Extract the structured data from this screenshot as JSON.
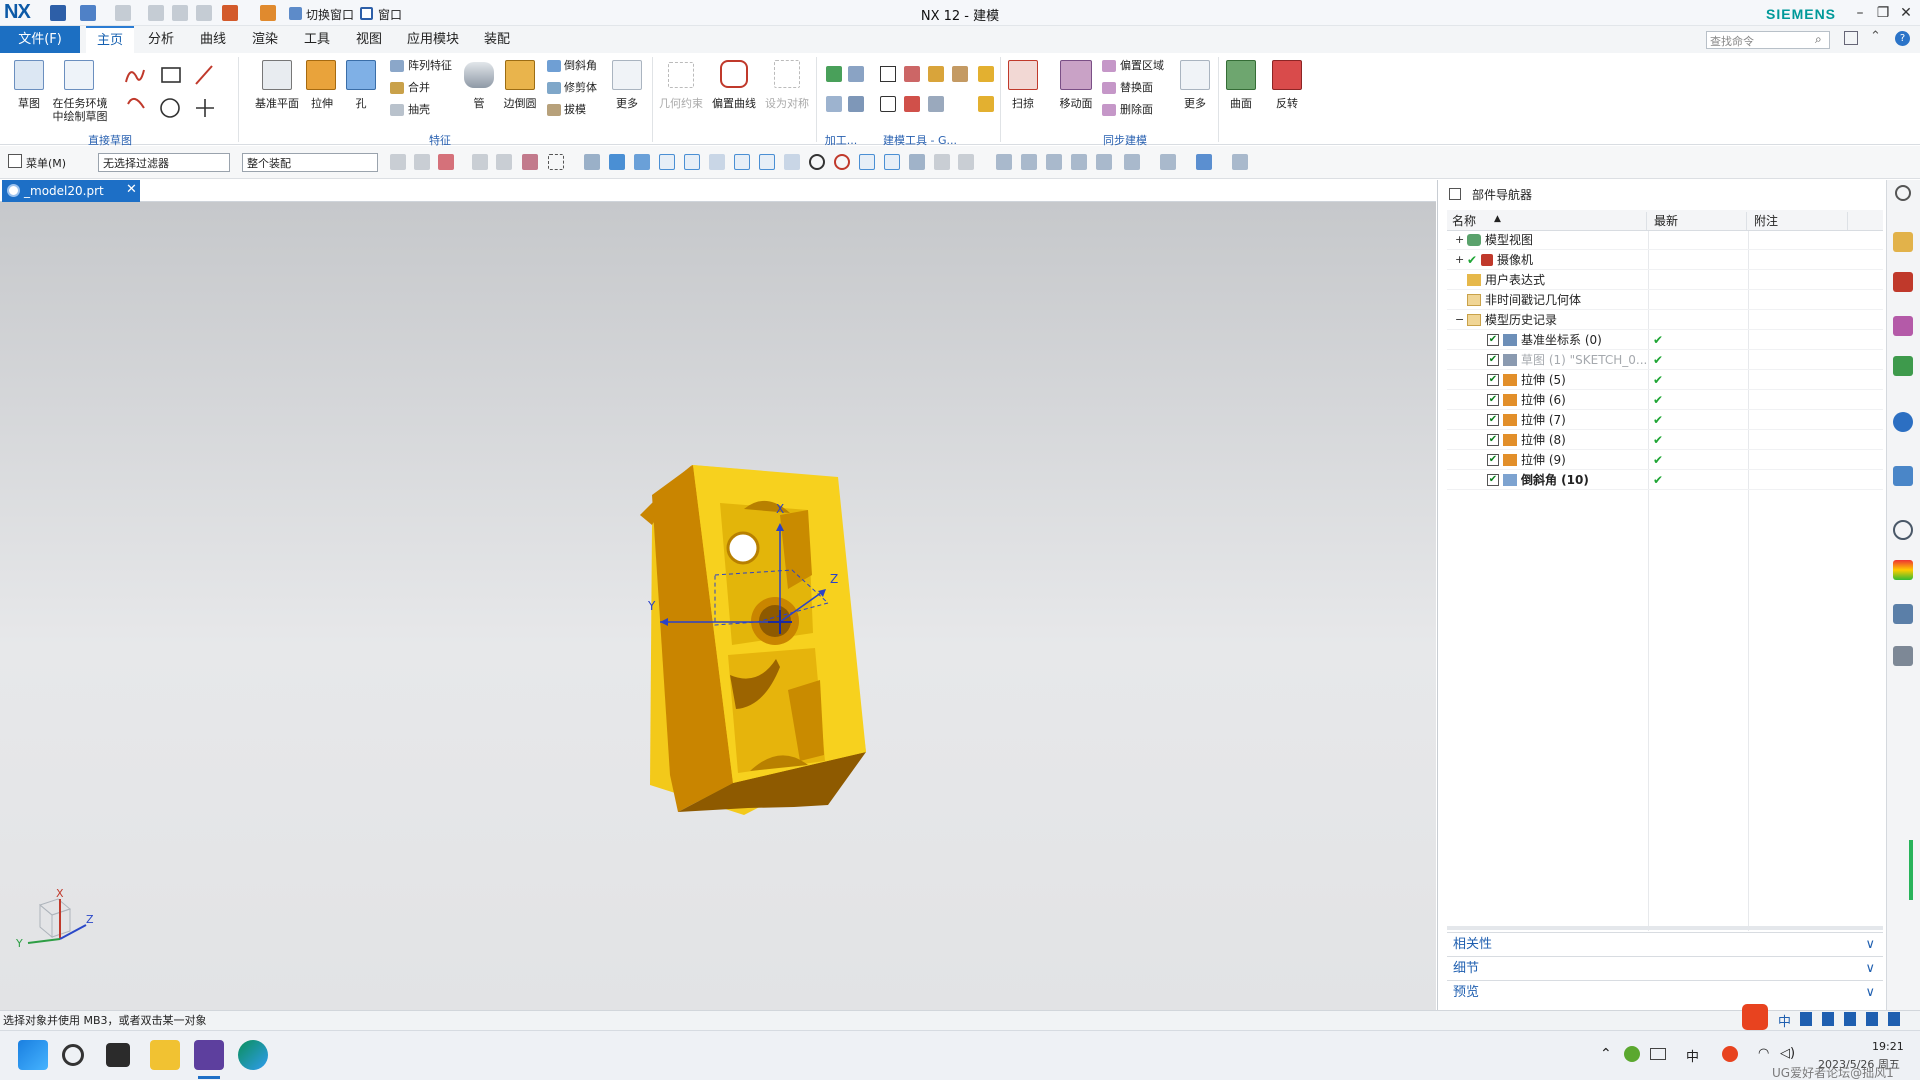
{
  "app": {
    "logo": "NX",
    "window_title": "NX 12 - 建模",
    "brand": "SIEMENS"
  },
  "quick_access": {
    "switch_window": "切换窗口",
    "window": "窗口"
  },
  "menu": {
    "file": "文件(F)",
    "tabs": [
      "主页",
      "分析",
      "曲线",
      "渲染",
      "工具",
      "视图",
      "应用模块",
      "装配"
    ],
    "active_tab": "主页",
    "search_placeholder": "查找命令"
  },
  "ribbon": {
    "sketch": "草图",
    "sketch_in_task": "在任务环境\n中绘制草图",
    "direct_sketch_group": "直接草图",
    "datum_plane": "基准平面",
    "extrude": "拉伸",
    "hole": "孔",
    "pattern_feature": "阵列特征",
    "unite": "合并",
    "shell": "抽壳",
    "tube": "管",
    "edge_blend": "边倒圆",
    "chamfer": "倒斜角",
    "trim_body": "修剪体",
    "draft": "拔模",
    "more": "更多",
    "feature_group": "特征",
    "geom_constraint": "几何约束",
    "offset_curve": "偏置曲线",
    "set_symmetric": "设为对称",
    "machining_group": "加工...",
    "modeling_tools_group": "建模工具 - G...",
    "sweep": "扫掠",
    "move_face": "移动面",
    "offset_region": "偏置区域",
    "replace_face": "替换面",
    "delete_face": "删除面",
    "more2": "更多",
    "sync_group": "同步建模",
    "surface": "曲面",
    "reverse": "反转"
  },
  "toolbar2": {
    "menu": "菜单(M)",
    "filter": "无选择过滤器",
    "scope": "整个装配"
  },
  "document": {
    "tab": "_model20.prt"
  },
  "navigator": {
    "title": "部件导航器",
    "columns": [
      "名称",
      "最新",
      "附注"
    ],
    "rows": [
      {
        "label": "模型视图",
        "check": false,
        "latest": ""
      },
      {
        "label": "摄像机",
        "check": false,
        "latest": ""
      },
      {
        "label": "用户表达式",
        "check": false,
        "latest": ""
      },
      {
        "label": "非时间戳记几何体",
        "check": false,
        "latest": ""
      },
      {
        "label": "模型历史记录",
        "check": false,
        "latest": ""
      },
      {
        "label": "基准坐标系 (0)",
        "check": true,
        "latest": "✔"
      },
      {
        "label": "草图 (1) \"SKETCH_0...",
        "check": true,
        "latest": "✔"
      },
      {
        "label": "拉伸 (5)",
        "check": true,
        "latest": "✔"
      },
      {
        "label": "拉伸 (6)",
        "check": true,
        "latest": "✔"
      },
      {
        "label": "拉伸 (7)",
        "check": true,
        "latest": "✔"
      },
      {
        "label": "拉伸 (8)",
        "check": true,
        "latest": "✔"
      },
      {
        "label": "拉伸 (9)",
        "check": true,
        "latest": "✔"
      },
      {
        "label": "倒斜角 (10)",
        "check": true,
        "latest": "✔"
      }
    ],
    "sections": [
      "相关性",
      "细节",
      "预览"
    ]
  },
  "axes": {
    "x": "X",
    "y": "Y",
    "z": "Z"
  },
  "status": {
    "message": "选择对象并使用 MB3，或者双击某一对象"
  },
  "taskbar": {
    "time": "19:21",
    "date": "2023/5/26 周五",
    "watermark": "UG爱好者论坛@拙风1",
    "ime": "中"
  },
  "colors": {
    "accent": "#1c6fc2",
    "part": "#f2c416",
    "part_side": "#c98a00",
    "check": "#1ea534"
  }
}
